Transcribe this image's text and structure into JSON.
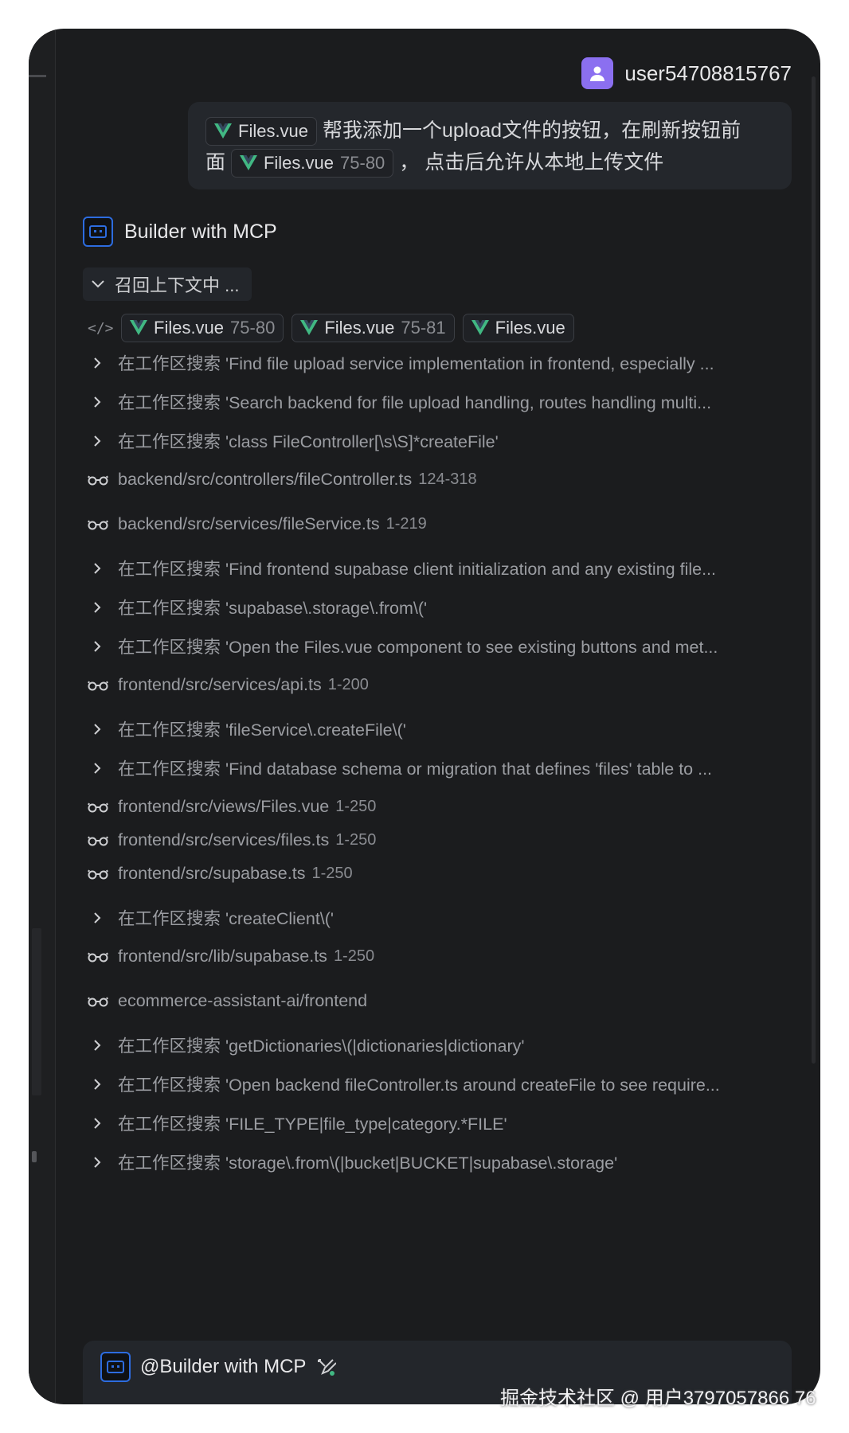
{
  "user": {
    "name": "user54708815767"
  },
  "message": {
    "chip1": {
      "file": "Files.vue"
    },
    "text1": "帮我添加一个upload文件的按钮，在刷新按钮前",
    "text2": "面",
    "chip2": {
      "file": "Files.vue",
      "range": "75-80"
    },
    "text3": "， 点击后允许从本地上传文件"
  },
  "assistant": {
    "title": "Builder with MCP"
  },
  "recall": {
    "label": "召回上下文中 ..."
  },
  "context_chips": [
    {
      "file": "Files.vue",
      "range": "75-80"
    },
    {
      "file": "Files.vue",
      "range": "75-81"
    },
    {
      "file": "Files.vue",
      "range": ""
    }
  ],
  "steps": [
    {
      "type": "search",
      "text": "在工作区搜索 'Find file upload service implementation in frontend, especially ..."
    },
    {
      "type": "search",
      "text": "在工作区搜索 'Search backend for file upload handling, routes handling multi..."
    },
    {
      "type": "search",
      "text": "在工作区搜索 'class FileController[\\s\\S]*createFile'"
    },
    {
      "type": "read",
      "text": "backend/src/controllers/fileController.ts",
      "range": "124-318"
    },
    {
      "type": "read",
      "text": "backend/src/services/fileService.ts",
      "range": "1-219"
    },
    {
      "type": "search",
      "text": "在工作区搜索 'Find frontend supabase client initialization and any existing file..."
    },
    {
      "type": "search",
      "text": "在工作区搜索 'supabase\\.storage\\.from\\('"
    },
    {
      "type": "search",
      "text": "在工作区搜索 'Open the Files.vue component to see existing buttons and met..."
    },
    {
      "type": "read",
      "text": "frontend/src/services/api.ts",
      "range": "1-200"
    },
    {
      "type": "search",
      "text": "在工作区搜索 'fileService\\.createFile\\('"
    },
    {
      "type": "search",
      "text": "在工作区搜索 'Find database schema or migration that defines 'files' table to ..."
    },
    {
      "type": "read",
      "text": "frontend/src/views/Files.vue",
      "range": "1-250"
    },
    {
      "type": "read",
      "text": "frontend/src/services/files.ts",
      "range": "1-250"
    },
    {
      "type": "read",
      "text": "frontend/src/supabase.ts",
      "range": "1-250"
    },
    {
      "type": "search",
      "text": "在工作区搜索 'createClient\\('"
    },
    {
      "type": "read",
      "text": "frontend/src/lib/supabase.ts",
      "range": "1-250"
    },
    {
      "type": "read",
      "text": "ecommerce-assistant-ai/frontend",
      "range": ""
    },
    {
      "type": "search",
      "text": "在工作区搜索 'getDictionaries\\(|dictionaries|dictionary'"
    },
    {
      "type": "search",
      "text": "在工作区搜索 'Open backend fileController.ts around createFile to see require..."
    },
    {
      "type": "search",
      "text": "在工作区搜索 'FILE_TYPE|file_type|category.*FILE'"
    },
    {
      "type": "search",
      "text": "在工作区搜索 'storage\\.from\\(|bucket|BUCKET|supabase\\.storage'"
    }
  ],
  "input": {
    "mention": "@Builder with MCP"
  },
  "watermark": "掘金技术社区 @ 用户3797057866 76",
  "colors": {
    "background": "#1b1c1e",
    "vue_green": "#41b883",
    "avatar": "#8b6ff0",
    "bot_blue": "#2d6cdf"
  }
}
